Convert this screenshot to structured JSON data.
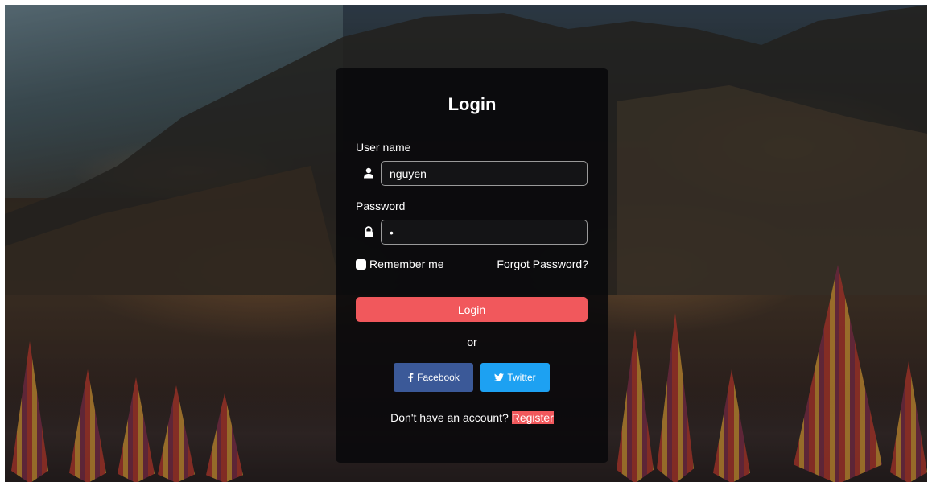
{
  "login": {
    "title": "Login",
    "username_label": "User name",
    "username_value": "nguyen",
    "password_label": "Password",
    "password_value": "•",
    "remember_label": "Remember me",
    "forgot_label": "Forgot Password?",
    "submit_label": "Login",
    "or_text": "or",
    "facebook_label": "Facebook",
    "twitter_label": "Twitter",
    "signup_text": "Don't have an account?",
    "register_label": "Register"
  },
  "icons": {
    "username": "user-icon",
    "password": "lock-icon",
    "facebook": "facebook-icon",
    "twitter": "twitter-icon"
  },
  "colors": {
    "accent": "#f1585c",
    "facebook": "#3b5998",
    "twitter": "#1da1f2",
    "card": "#08080a"
  }
}
